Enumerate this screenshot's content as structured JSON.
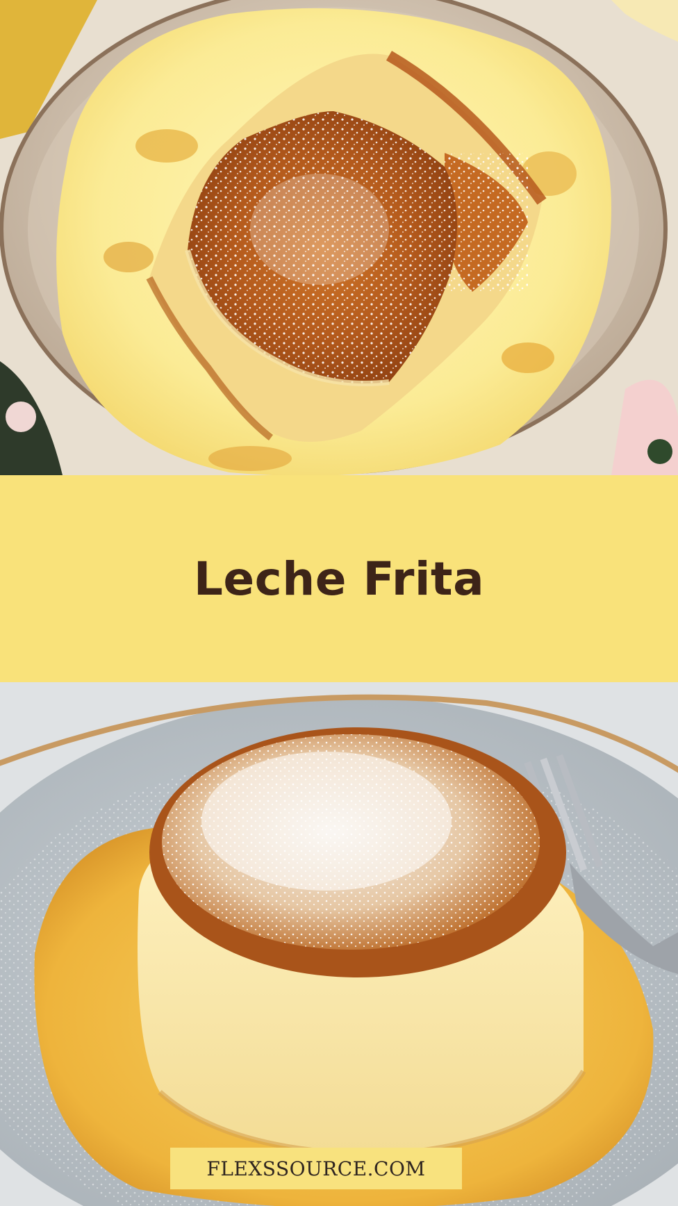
{
  "title": "Leche Frita",
  "watermark": "FLEXSSOURCE.COM",
  "images": {
    "top": "fried milk squares dusted with powdered sugar on a speckled plate with custard sauce",
    "bottom": "round fried milk cake dusted with powdered sugar, fork, caramel sauce on grey plate"
  },
  "colors": {
    "band": "#f9e27a",
    "title": "#3d2418",
    "watermark_bg": "#f8e27e",
    "watermark_text": "#2f2520"
  }
}
